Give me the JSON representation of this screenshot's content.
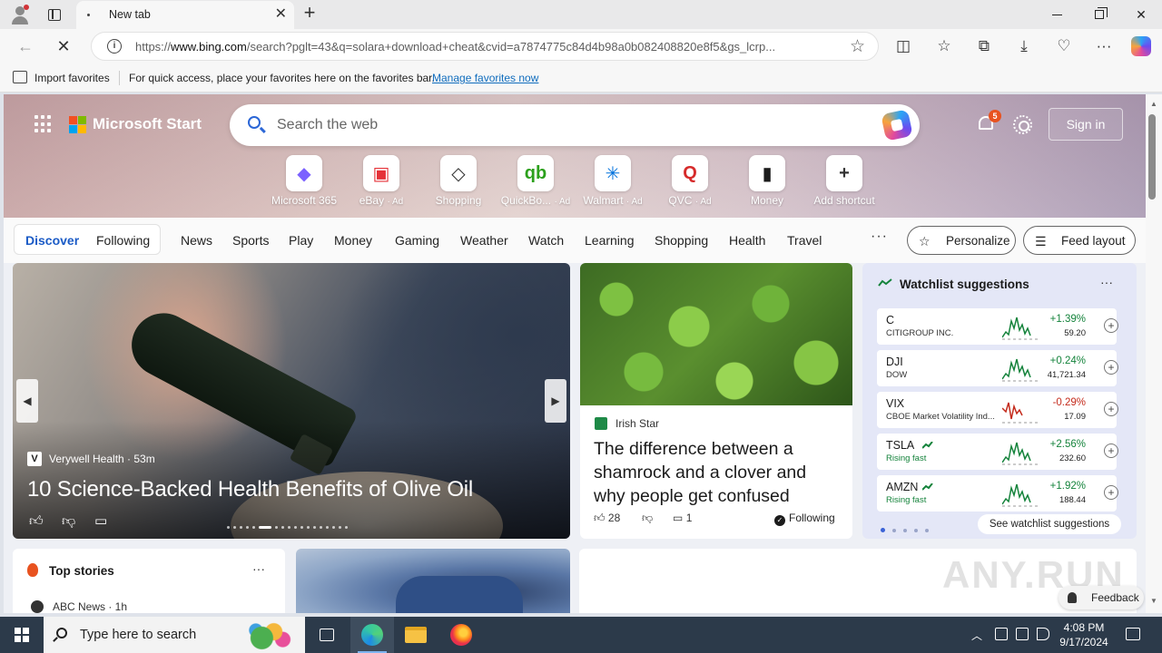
{
  "browser": {
    "tab_title": "New tab",
    "url_prefix": "https://",
    "url_host": "www.bing.com",
    "url_rest": "/search?pglt=43&q=solara+download+cheat&cvid=a7874775c84d4b98a0b082408820e8f5&gs_lcrp...",
    "favorites_bar": {
      "import_label": "Import favorites",
      "message": "For quick access, place your favorites here on the favorites bar.",
      "manage_link": "Manage favorites now"
    }
  },
  "header": {
    "brand": "Microsoft Start",
    "search_placeholder": "Search the web",
    "notification_count": "5",
    "sign_in": "Sign in"
  },
  "shortcuts": [
    {
      "label": "Microsoft 365",
      "ad": "",
      "icon": "microsoft-365-icon",
      "color": "#7b61ff"
    },
    {
      "label": "eBay",
      "ad": "· Ad",
      "icon": "ebay-icon",
      "color": "#e53238"
    },
    {
      "label": "Shopping",
      "ad": "",
      "icon": "shopping-tag-icon",
      "color": "#333333"
    },
    {
      "label": "QuickBo...",
      "ad": "· Ad",
      "icon": "quickbooks-icon",
      "color": "#2ca01c"
    },
    {
      "label": "Walmart",
      "ad": "· Ad",
      "icon": "walmart-icon",
      "color": "#0071dc"
    },
    {
      "label": "QVC",
      "ad": "· Ad",
      "icon": "qvc-icon",
      "color": "#d62b2b"
    },
    {
      "label": "Money",
      "ad": "",
      "icon": "money-chart-icon",
      "color": "#1b1b1b"
    },
    {
      "label": "Add shortcut",
      "ad": "",
      "icon": "plus-icon",
      "color": "#333333"
    }
  ],
  "nav": {
    "discover": "Discover",
    "following": "Following",
    "tabs": [
      "News",
      "Sports",
      "Play",
      "Money",
      "Gaming",
      "Weather",
      "Watch",
      "Learning",
      "Shopping",
      "Health",
      "Travel"
    ],
    "more": "···",
    "personalize": "Personalize",
    "feed_layout": "Feed layout"
  },
  "hero": {
    "source": "Verywell Health · 53m",
    "source_logo": "V",
    "title": "10 Science-Backed Health Benefits of Olive Oil",
    "active_dot": 5,
    "dot_count": 18
  },
  "news": {
    "source": "Irish Star",
    "title": "The difference between a shamrock and a clover and why people get confused",
    "likes": "28",
    "comments": "1",
    "following": "Following"
  },
  "watchlist": {
    "title": "Watchlist suggestions",
    "items": [
      {
        "symbol": "C",
        "name": "CITIGROUP INC.",
        "change": "+1.39%",
        "price": "59.20",
        "direction": "up"
      },
      {
        "symbol": "DJI",
        "name": "DOW",
        "change": "+0.24%",
        "price": "41,721.34",
        "direction": "up"
      },
      {
        "symbol": "VIX",
        "name": "CBOE Market Volatility Ind...",
        "change": "-0.29%",
        "price": "17.09",
        "direction": "down"
      },
      {
        "symbol": "TSLA",
        "name": "Rising fast",
        "change": "+2.56%",
        "price": "232.60",
        "direction": "up"
      },
      {
        "symbol": "AMZN",
        "name": "Rising fast",
        "change": "+1.92%",
        "price": "188.44",
        "direction": "up"
      }
    ],
    "see_all": "See watchlist suggestions"
  },
  "lower": {
    "top_stories": "Top stories",
    "top_source": "ABC News · 1h",
    "feedback": "Feedback",
    "watermark": "ANY.RUN"
  },
  "taskbar": {
    "search_placeholder": "Type here to search",
    "time": "4:08 PM",
    "date": "9/17/2024"
  }
}
